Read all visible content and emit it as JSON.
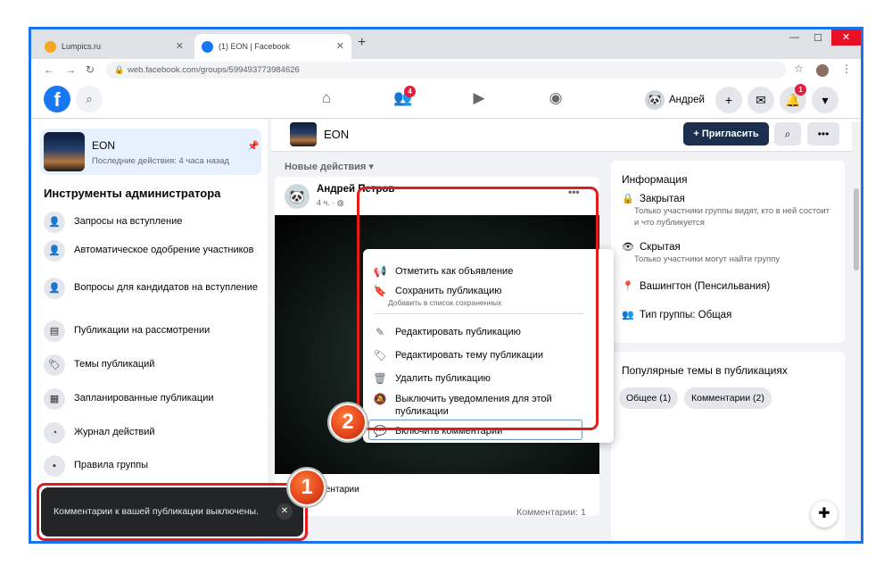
{
  "browser": {
    "tabs": [
      {
        "title": "Lumpics.ru",
        "favicon_color": "#f5a623"
      },
      {
        "title": "(1) EON | Facebook",
        "favicon_color": "#1877f2"
      }
    ],
    "url": "web.facebook.com/groups/599493773984626"
  },
  "topbar": {
    "friends_badge": "4",
    "user_name": "Андрей",
    "notifications_badge": "1"
  },
  "sidebar": {
    "group_name": "EON",
    "group_last_activity": "Последние действия: 4 часа назад",
    "admin_title": "Инструменты администратора",
    "items": [
      {
        "label": "Запросы на вступление"
      },
      {
        "label": "Автоматическое одобрение участников"
      },
      {
        "label": "Вопросы для кандидатов на вступление"
      },
      {
        "label": "Публикации на рассмотрении"
      },
      {
        "label": "Темы публикаций"
      },
      {
        "label": "Запланированные публикации"
      },
      {
        "label": "Журнал действий"
      },
      {
        "label": "Правила группы"
      }
    ]
  },
  "group_header": {
    "title": "EON",
    "invite_label": "+ Пригласить"
  },
  "feed": {
    "sort_label": "Новые действия",
    "post": {
      "author": "Андрей Петров",
      "time": "4 ч. ·",
      "partial_label": "ментарии",
      "comments_count": "Комментарии: 1"
    }
  },
  "menu": {
    "items": [
      {
        "label": "Отметить как объявление"
      },
      {
        "label": "Сохранить публикацию",
        "sub": "Добавить в список сохраненных"
      },
      {
        "label": "Редактировать публикацию"
      },
      {
        "label": "Редактировать тему публикации"
      },
      {
        "label": "Удалить публикацию"
      },
      {
        "label": "Выключить уведомления для этой публикации"
      },
      {
        "label": "Включить комментарии"
      }
    ]
  },
  "info": {
    "title": "Информация",
    "items": [
      {
        "label": "Закрытая",
        "sub": "Только участники группы видят, кто в ней состоит и что публикуется"
      },
      {
        "label": "Скрытая",
        "sub": "Только участники могут найти группу"
      },
      {
        "label": "Вашингтон (Пенсильвания)"
      },
      {
        "label": "Тип группы: Общая"
      }
    ]
  },
  "topics": {
    "title": "Популярные темы в публикациях",
    "chips": [
      "Общее (1)",
      "Комментарии (2)"
    ]
  },
  "toast": {
    "text": "Комментарии к вашей публикации выключены."
  },
  "annotations": {
    "step1": "1",
    "step2": "2",
    "highlight_color": "#e21b1b"
  }
}
